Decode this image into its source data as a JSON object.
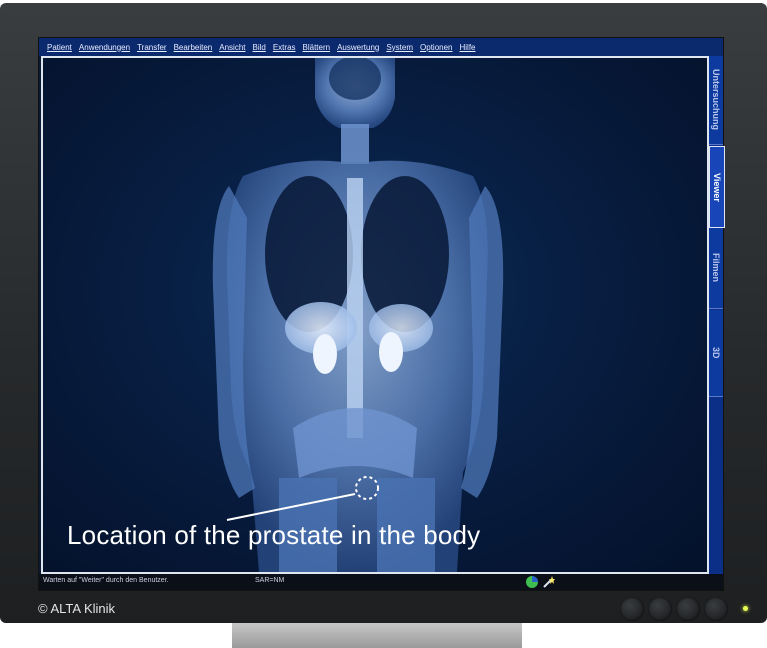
{
  "menu": [
    "Patient",
    "Anwendungen",
    "Transfer",
    "Bearbeiten",
    "Ansicht",
    "Bild",
    "Extras",
    "Blättern",
    "Auswertung",
    "System",
    "Optionen",
    "Hilfe"
  ],
  "side_tabs": [
    "Untersuchung",
    "Viewer",
    "Filmen",
    "3D"
  ],
  "active_tab": "Viewer",
  "status": {
    "left": "Warten auf \"Weiter\" durch den Benutzer.",
    "middle": "SAR=NM"
  },
  "caption": "Location of the prostate in the body",
  "copyright": "© ALTA Klinik",
  "icons": [
    "progress-pie-icon",
    "magic-wand-icon"
  ],
  "colors": {
    "menu_bar": "#0b2a6e",
    "side_tabs": "#0d3a9e",
    "led": "#e8ff55"
  }
}
